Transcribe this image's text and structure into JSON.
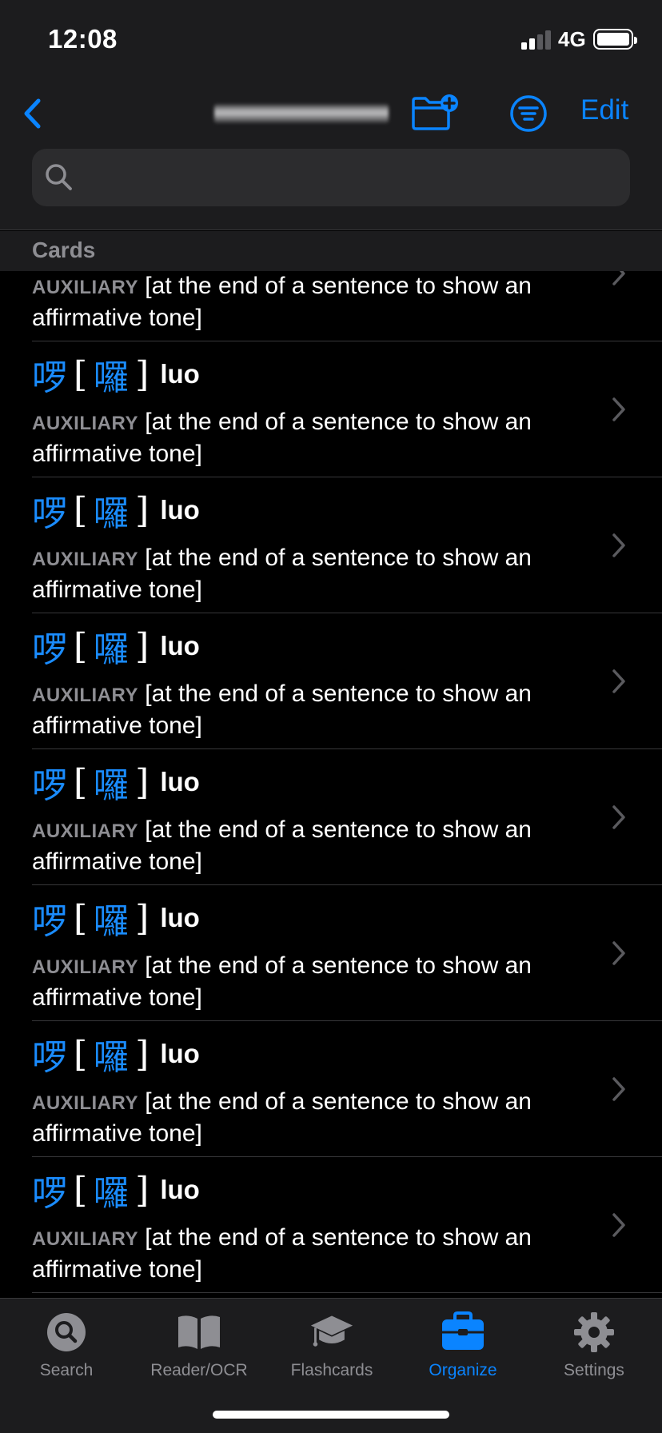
{
  "status_bar": {
    "time": "12:08",
    "network": "4G",
    "signal_bars": 2,
    "signal_bars_total": 4,
    "battery_level": 1.0
  },
  "nav": {
    "back_icon": "chevron-left-icon",
    "title_redacted": true,
    "folder_add_icon": "folder-plus-icon",
    "filter_icon": "filter-lines-icon",
    "edit_label": "Edit"
  },
  "search": {
    "value": "",
    "placeholder": ""
  },
  "section": {
    "title": "Cards"
  },
  "list": {
    "partial_first_row": {
      "part_of_speech": "AUXILIARY",
      "definition": "[at the end of a sentence to show an affirmative tone]"
    },
    "items": [
      {
        "simplified": "啰",
        "traditional": "囉",
        "pinyin": "luo",
        "part_of_speech": "AUXILIARY",
        "definition": "[at the end of a sentence to show an affirmative tone]"
      },
      {
        "simplified": "啰",
        "traditional": "囉",
        "pinyin": "luo",
        "part_of_speech": "AUXILIARY",
        "definition": "[at the end of a sentence to show an affirmative tone]"
      },
      {
        "simplified": "啰",
        "traditional": "囉",
        "pinyin": "luo",
        "part_of_speech": "AUXILIARY",
        "definition": "[at the end of a sentence to show an affirmative tone]"
      },
      {
        "simplified": "啰",
        "traditional": "囉",
        "pinyin": "luo",
        "part_of_speech": "AUXILIARY",
        "definition": "[at the end of a sentence to show an affirmative tone]"
      },
      {
        "simplified": "啰",
        "traditional": "囉",
        "pinyin": "luo",
        "part_of_speech": "AUXILIARY",
        "definition": "[at the end of a sentence to show an affirmative tone]"
      },
      {
        "simplified": "啰",
        "traditional": "囉",
        "pinyin": "luo",
        "part_of_speech": "AUXILIARY",
        "definition": "[at the end of a sentence to show an affirmative tone]"
      },
      {
        "simplified": "啰",
        "traditional": "囉",
        "pinyin": "luo",
        "part_of_speech": "AUXILIARY",
        "definition": "[at the end of a sentence to show an affirmative tone]"
      }
    ],
    "open_bracket": "[",
    "close_bracket": "]"
  },
  "tabbar": {
    "tabs": [
      {
        "label": "Search",
        "icon": "search-icon",
        "active": false
      },
      {
        "label": "Reader/OCR",
        "icon": "book-open-icon",
        "active": false
      },
      {
        "label": "Flashcards",
        "icon": "graduation-cap-icon",
        "active": false
      },
      {
        "label": "Organize",
        "icon": "toolbox-icon",
        "active": true
      },
      {
        "label": "Settings",
        "icon": "gear-icon",
        "active": false
      }
    ]
  },
  "colors": {
    "accent": "#0a84ff",
    "hanzi": "#1a8cff",
    "secondary_text": "#8e8e93",
    "background": "#000000",
    "bar_background": "#1c1c1e"
  }
}
